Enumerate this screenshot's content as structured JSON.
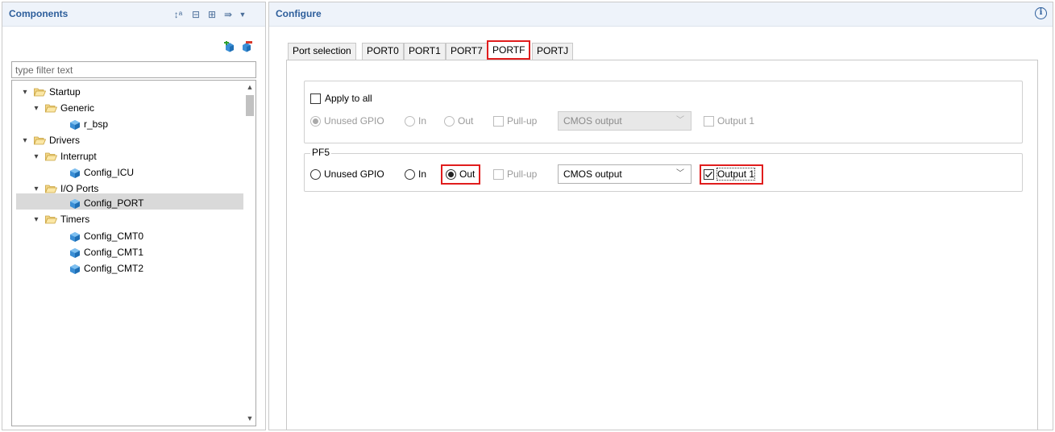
{
  "components": {
    "title": "Components",
    "filter_placeholder": "type filter text",
    "tree": [
      {
        "label": "Startup"
      },
      {
        "label": "Generic"
      },
      {
        "label": "r_bsp"
      },
      {
        "label": "Drivers"
      },
      {
        "label": "Interrupt"
      },
      {
        "label": "Config_ICU"
      },
      {
        "label": "I/O Ports"
      },
      {
        "label": "Config_PORT"
      },
      {
        "label": "Timers"
      },
      {
        "label": "Config_CMT0"
      },
      {
        "label": "Config_CMT1"
      },
      {
        "label": "Config_CMT2"
      }
    ],
    "selected": "Config_PORT"
  },
  "configure": {
    "title": "Configure",
    "tabs": [
      {
        "label": "Port selection"
      },
      {
        "label": "PORT0"
      },
      {
        "label": "PORT1"
      },
      {
        "label": "PORT7"
      },
      {
        "label": "PORTF"
      },
      {
        "label": "PORTJ"
      }
    ],
    "active_tab": "PORTF",
    "apply_all": {
      "checkbox_label": "Apply to all",
      "checked": false,
      "unused_gpio": "Unused GPIO",
      "in": "In",
      "out": "Out",
      "pullup": "Pull-up",
      "output_type": "CMOS output",
      "output1": "Output 1"
    },
    "pf5": {
      "legend": "PF5",
      "unused_gpio": "Unused GPIO",
      "in": "In",
      "out": "Out",
      "selected_direction": "Out",
      "pullup": "Pull-up",
      "output_type": "CMOS output",
      "output1": "Output 1",
      "output1_checked": true
    }
  },
  "colors": {
    "header_bg": "#eef3fa",
    "title_blue": "#2d5e9b",
    "highlight_red": "#e01d1d",
    "selection_gray": "#d9d9d9"
  }
}
